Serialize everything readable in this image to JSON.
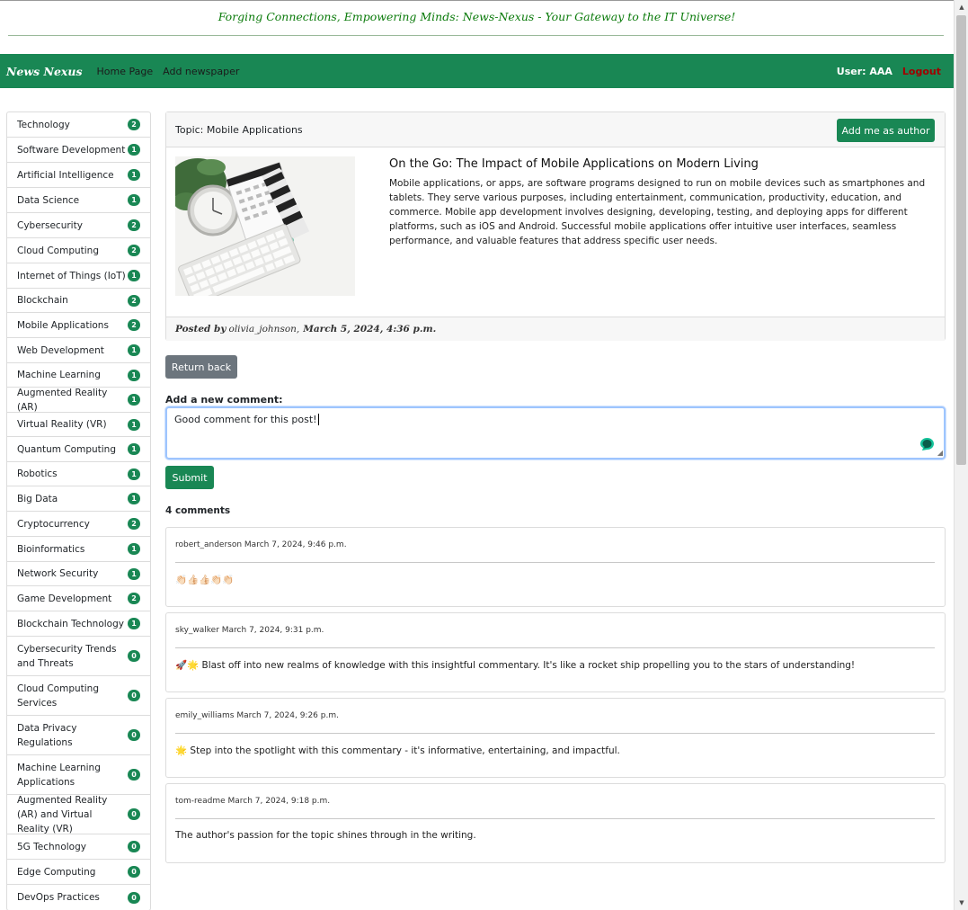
{
  "tagline": "Forging Connections, Empowering Minds: News-Nexus - Your Gateway to the IT Universe!",
  "nav": {
    "brand": "News Nexus",
    "links": [
      "Home Page",
      "Add newspaper"
    ],
    "user": "User: AAA",
    "logout": "Logout"
  },
  "sidebar": {
    "items": [
      {
        "label": "Technology",
        "count": "2"
      },
      {
        "label": "Software Development",
        "count": "1"
      },
      {
        "label": "Artificial Intelligence",
        "count": "1"
      },
      {
        "label": "Data Science",
        "count": "1"
      },
      {
        "label": "Cybersecurity",
        "count": "2"
      },
      {
        "label": "Cloud Computing",
        "count": "2"
      },
      {
        "label": "Internet of Things (IoT)",
        "count": "1"
      },
      {
        "label": "Blockchain",
        "count": "2"
      },
      {
        "label": "Mobile Applications",
        "count": "2"
      },
      {
        "label": "Web Development",
        "count": "1"
      },
      {
        "label": "Machine Learning",
        "count": "1"
      },
      {
        "label": "Augmented Reality (AR)",
        "count": "1"
      },
      {
        "label": "Virtual Reality (VR)",
        "count": "1"
      },
      {
        "label": "Quantum Computing",
        "count": "1"
      },
      {
        "label": "Robotics",
        "count": "1"
      },
      {
        "label": "Big Data",
        "count": "1"
      },
      {
        "label": "Cryptocurrency",
        "count": "2"
      },
      {
        "label": "Bioinformatics",
        "count": "1"
      },
      {
        "label": "Network Security",
        "count": "1"
      },
      {
        "label": "Game Development",
        "count": "2"
      },
      {
        "label": "Blockchain Technology",
        "count": "1"
      },
      {
        "label": "Cybersecurity Trends and Threats",
        "count": "0"
      },
      {
        "label": "Cloud Computing Services",
        "count": "0"
      },
      {
        "label": "Data Privacy Regulations",
        "count": "0"
      },
      {
        "label": "Machine Learning Applications",
        "count": "0"
      },
      {
        "label": "Augmented Reality (AR) and Virtual Reality (VR)",
        "count": "0"
      },
      {
        "label": "5G Technology",
        "count": "0"
      },
      {
        "label": "Edge Computing",
        "count": "0"
      },
      {
        "label": "DevOps Practices",
        "count": "0"
      }
    ]
  },
  "post": {
    "topic": "Topic: Mobile Applications",
    "add_author_label": "Add me as author",
    "title": "On the Go: The Impact of Mobile Applications on Modern Living",
    "body": "Mobile applications, or apps, are software programs designed to run on mobile devices such as smartphones and tablets. They serve various purposes, including entertainment, communication, productivity, education, and commerce. Mobile app development involves designing, developing, testing, and deploying apps for different platforms, such as iOS and Android. Successful mobile applications offer intuitive user interfaces, seamless performance, and valuable features that address specific user needs.",
    "posted_by_label": "Posted by",
    "author": "olivia_johnson,",
    "date": "March 5, 2024, 4:36 p.m."
  },
  "return_label": "Return back",
  "comment_form": {
    "label": "Add a new comment:",
    "value": "Good comment for this post!",
    "submit_label": "Submit"
  },
  "comments_count": "4 comments",
  "comments": [
    {
      "meta": "robert_anderson March 7, 2024, 9:46 p.m.",
      "text": "👏🏻👍🏻👍🏻👏🏻👏🏻"
    },
    {
      "meta": "sky_walker March 7, 2024, 9:31 p.m.",
      "text": "🚀🌟 Blast off into new realms of knowledge with this insightful commentary. It's like a rocket ship propelling you to the stars of understanding!"
    },
    {
      "meta": "emily_williams March 7, 2024, 9:26 p.m.",
      "text": "🌟 Step into the spotlight with this commentary - it's informative, entertaining, and impactful."
    },
    {
      "meta": "tom-readme March 7, 2024, 9:18 p.m.",
      "text": "The author's passion for the topic shines through in the writing."
    }
  ],
  "colors": {
    "accent": "#198754",
    "logout": "#a10000",
    "tagline": "#0a7a0a",
    "secondary_button": "#6c757d"
  }
}
